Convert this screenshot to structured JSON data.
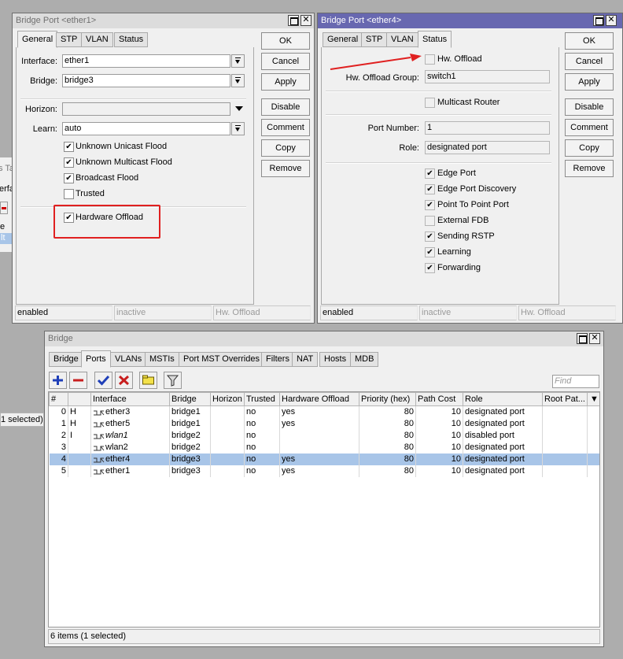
{
  "background_fragments": {
    "tab_text": "s Ta",
    "col_text": "erfa",
    "row_text": "e",
    "sel_text": "lt",
    "status_text": "1 selected)"
  },
  "win1": {
    "title": "Bridge Port <ether1>",
    "tabs": [
      "General",
      "STP",
      "VLAN",
      "Status"
    ],
    "interface_label": "Interface:",
    "interface_value": "ether1",
    "bridge_label": "Bridge:",
    "bridge_value": "bridge3",
    "horizon_label": "Horizon:",
    "horizon_value": "",
    "learn_label": "Learn:",
    "learn_value": "auto",
    "checks": [
      {
        "label": "Unknown Unicast Flood",
        "checked": true
      },
      {
        "label": "Unknown Multicast Flood",
        "checked": true
      },
      {
        "label": "Broadcast Flood",
        "checked": true
      },
      {
        "label": "Trusted",
        "checked": false
      }
    ],
    "hw_offload_label": "Hardware Offload",
    "hw_offload_checked": true,
    "buttons": [
      "OK",
      "Cancel",
      "Apply",
      "Disable",
      "Comment",
      "Copy",
      "Remove"
    ],
    "status": [
      "enabled",
      "inactive",
      "Hw. Offload"
    ]
  },
  "win2": {
    "title": "Bridge Port <ether4>",
    "tabs": [
      "General",
      "STP",
      "VLAN",
      "Status"
    ],
    "hw_offload_label": "Hw. Offload",
    "hw_offload_group_label": "Hw. Offload Group:",
    "hw_offload_group_value": "switch1",
    "multicast_router_label": "Multicast Router",
    "port_number_label": "Port Number:",
    "port_number_value": "1",
    "role_label": "Role:",
    "role_value": "designated port",
    "checks": [
      {
        "label": "Edge Port",
        "checked": true
      },
      {
        "label": "Edge Port Discovery",
        "checked": true
      },
      {
        "label": "Point To Point Port",
        "checked": true
      },
      {
        "label": "External FDB",
        "checked": false
      },
      {
        "label": "Sending RSTP",
        "checked": true
      },
      {
        "label": "Learning",
        "checked": true
      },
      {
        "label": "Forwarding",
        "checked": true
      }
    ],
    "buttons": [
      "OK",
      "Cancel",
      "Apply",
      "Disable",
      "Comment",
      "Copy",
      "Remove"
    ],
    "status": [
      "enabled",
      "inactive",
      "Hw. Offload"
    ]
  },
  "bridge": {
    "title": "Bridge",
    "tabs": [
      "Bridge",
      "Ports",
      "VLANs",
      "MSTIs",
      "Port MST Overrides",
      "Filters",
      "NAT",
      "Hosts",
      "MDB"
    ],
    "find_placeholder": "Find",
    "columns": [
      "#",
      "",
      "Interface",
      "Bridge",
      "Horizon",
      "Trusted",
      "Hardware Offload",
      "Priority (hex)",
      "Path Cost",
      "Role",
      "Root Pat..."
    ],
    "rows": [
      {
        "num": "0",
        "flag": "H",
        "iface": "ether3",
        "bridge": "bridge1",
        "horizon": "",
        "trusted": "no",
        "hw": "yes",
        "prio": "80",
        "cost": "10",
        "role": "designated port",
        "root": "",
        "italic": false,
        "selected": false
      },
      {
        "num": "1",
        "flag": "H",
        "iface": "ether5",
        "bridge": "bridge1",
        "horizon": "",
        "trusted": "no",
        "hw": "yes",
        "prio": "80",
        "cost": "10",
        "role": "designated port",
        "root": "",
        "italic": false,
        "selected": false
      },
      {
        "num": "2",
        "flag": "I",
        "iface": "wlan1",
        "bridge": "bridge2",
        "horizon": "",
        "trusted": "no",
        "hw": "",
        "prio": "80",
        "cost": "10",
        "role": "disabled port",
        "root": "",
        "italic": true,
        "selected": false
      },
      {
        "num": "3",
        "flag": "",
        "iface": "wlan2",
        "bridge": "bridge2",
        "horizon": "",
        "trusted": "no",
        "hw": "",
        "prio": "80",
        "cost": "10",
        "role": "designated port",
        "root": "",
        "italic": false,
        "selected": false
      },
      {
        "num": "4",
        "flag": "",
        "iface": "ether4",
        "bridge": "bridge3",
        "horizon": "",
        "trusted": "no",
        "hw": "yes",
        "prio": "80",
        "cost": "10",
        "role": "designated port",
        "root": "",
        "italic": false,
        "selected": true
      },
      {
        "num": "5",
        "flag": "",
        "iface": "ether1",
        "bridge": "bridge3",
        "horizon": "",
        "trusted": "no",
        "hw": "yes",
        "prio": "80",
        "cost": "10",
        "role": "designated port",
        "root": "",
        "italic": false,
        "selected": false
      }
    ],
    "status": "6 items (1 selected)"
  },
  "colors": {
    "highlight_box": "#e02020",
    "arrow": "#e02020",
    "selected_row": "#a8c5e8",
    "active_title": "#6868b0"
  },
  "icons": {
    "add": "plus-icon",
    "remove": "minus-icon",
    "enable": "check-icon",
    "disable": "x-icon",
    "comment": "comment-icon",
    "filter": "filter-icon"
  }
}
